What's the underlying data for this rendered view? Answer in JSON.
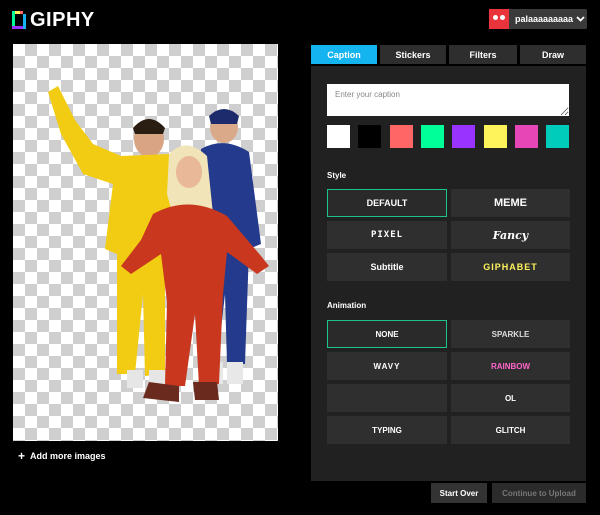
{
  "header": {
    "logo_text": "GIPHY",
    "username": "palaaaaaaaaa"
  },
  "editor": {
    "add_more_images_label": "Add more images"
  },
  "tabs": [
    "Caption",
    "Stickers",
    "Filters",
    "Draw"
  ],
  "caption": {
    "placeholder": "Enter your caption",
    "colors": [
      "#ffffff",
      "#000000",
      "#ff6666",
      "#00ff99",
      "#9933ff",
      "#fff35c",
      "#e646b6",
      "#00ccbb"
    ]
  },
  "style": {
    "label": "Style",
    "options": [
      "DEFAULT",
      "MEME",
      "PIXEL",
      "Fancy",
      "Subtitle",
      "GIPHABET"
    ]
  },
  "animation": {
    "label": "Animation",
    "options": [
      "NONE",
      "SPARKLE",
      "WAVY",
      "RAINBOW",
      "",
      "OL",
      "TYPING",
      "GLITCH"
    ]
  },
  "footer": {
    "start_over_label": "Start Over",
    "continue_label": "Continue to Upload"
  },
  "accent_color": "#14b4f0",
  "selected_border_color": "#1ec28c"
}
